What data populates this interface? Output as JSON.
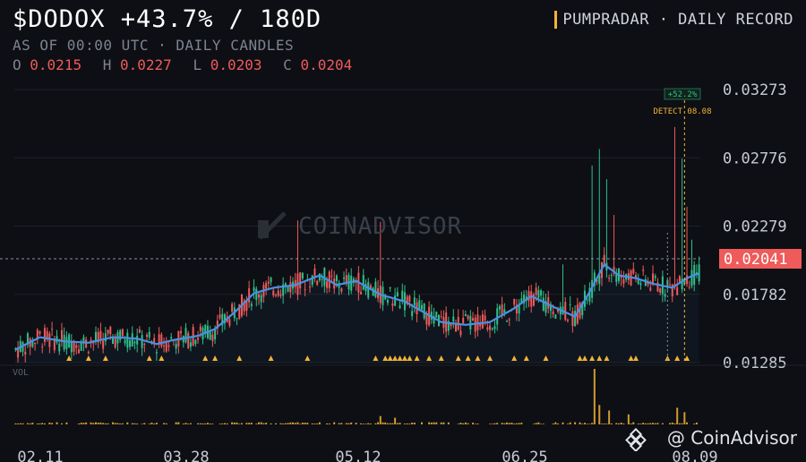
{
  "header": {
    "title": "$DODOX +43.7% / 180D",
    "subtitle": "AS OF 00:00 UTC · DAILY CANDLES",
    "ohlc": [
      {
        "key": "O",
        "value": "0.0215"
      },
      {
        "key": "H",
        "value": "0.0227"
      },
      {
        "key": "L",
        "value": "0.0203"
      },
      {
        "key": "C",
        "value": "0.0204"
      }
    ],
    "source": "PUMPRADAR · DAILY RECORD"
  },
  "watermark": "COINADVISOR",
  "credit": "@ CoinAdvisor",
  "colors": {
    "up": "#2fbf8a",
    "down": "#ef5a5a",
    "ma": "#4a90e2",
    "marker": "#f3b335",
    "background": "#0d0f14"
  },
  "chart_data": {
    "type": "candlestick",
    "y_ticks": [
      "0.03273",
      "0.02776",
      "0.02279",
      "0.01782",
      "0.01285"
    ],
    "ylim": [
      0.01285,
      0.03273
    ],
    "x_ticks": [
      "02.11",
      "03.28",
      "05.12",
      "06.25",
      "08.09"
    ],
    "current_price": "0.02041",
    "annotations": {
      "pump_pct": "+52.2%",
      "detect_label": "DETECT 08.08"
    },
    "volume_label": "VOL",
    "ma_anchors": [
      [
        0,
        0.0138
      ],
      [
        10,
        0.0147
      ],
      [
        20,
        0.0144
      ],
      [
        30,
        0.0143
      ],
      [
        40,
        0.0147
      ],
      [
        50,
        0.0146
      ],
      [
        58,
        0.0142
      ],
      [
        65,
        0.0145
      ],
      [
        75,
        0.0148
      ],
      [
        82,
        0.0153
      ],
      [
        90,
        0.0165
      ],
      [
        98,
        0.0179
      ],
      [
        106,
        0.0183
      ],
      [
        115,
        0.0185
      ],
      [
        125,
        0.0192
      ],
      [
        132,
        0.0185
      ],
      [
        140,
        0.0188
      ],
      [
        150,
        0.0178
      ],
      [
        160,
        0.0173
      ],
      [
        168,
        0.0165
      ],
      [
        175,
        0.0158
      ],
      [
        185,
        0.0156
      ],
      [
        195,
        0.0158
      ],
      [
        205,
        0.0168
      ],
      [
        212,
        0.0177
      ],
      [
        220,
        0.017
      ],
      [
        230,
        0.0162
      ],
      [
        236,
        0.018
      ],
      [
        242,
        0.02
      ],
      [
        248,
        0.0192
      ],
      [
        255,
        0.019
      ],
      [
        262,
        0.0186
      ],
      [
        270,
        0.0183
      ],
      [
        276,
        0.019
      ],
      [
        280,
        0.0193
      ]
    ],
    "spikes": [
      {
        "i": 116,
        "high": 0.0232
      },
      {
        "i": 150,
        "high": 0.0231
      },
      {
        "i": 225,
        "high": 0.02
      },
      {
        "i": 237,
        "high": 0.0272
      },
      {
        "i": 240,
        "high": 0.0284
      },
      {
        "i": 243,
        "high": 0.0262
      },
      {
        "i": 246,
        "high": 0.0236
      },
      {
        "i": 271,
        "high": 0.03
      },
      {
        "i": 274,
        "high": 0.0277
      },
      {
        "i": 276,
        "high": 0.0242
      },
      {
        "i": 278,
        "high": 0.0218
      }
    ],
    "marker_indices": [
      22,
      30,
      37,
      55,
      60,
      78,
      82,
      92,
      105,
      120,
      148,
      152,
      154,
      156,
      158,
      160,
      162,
      165,
      170,
      175,
      182,
      186,
      190,
      195,
      205,
      210,
      218,
      232,
      234,
      237,
      240,
      243,
      253,
      255,
      268,
      272,
      276
    ],
    "volume_spikes": [
      {
        "i": 238,
        "v": 1.0
      },
      {
        "i": 240,
        "v": 0.35
      },
      {
        "i": 244,
        "v": 0.25
      },
      {
        "i": 150,
        "v": 0.15
      },
      {
        "i": 156,
        "v": 0.12
      },
      {
        "i": 252,
        "v": 0.18
      },
      {
        "i": 272,
        "v": 0.3
      },
      {
        "i": 275,
        "v": 0.22
      }
    ]
  }
}
